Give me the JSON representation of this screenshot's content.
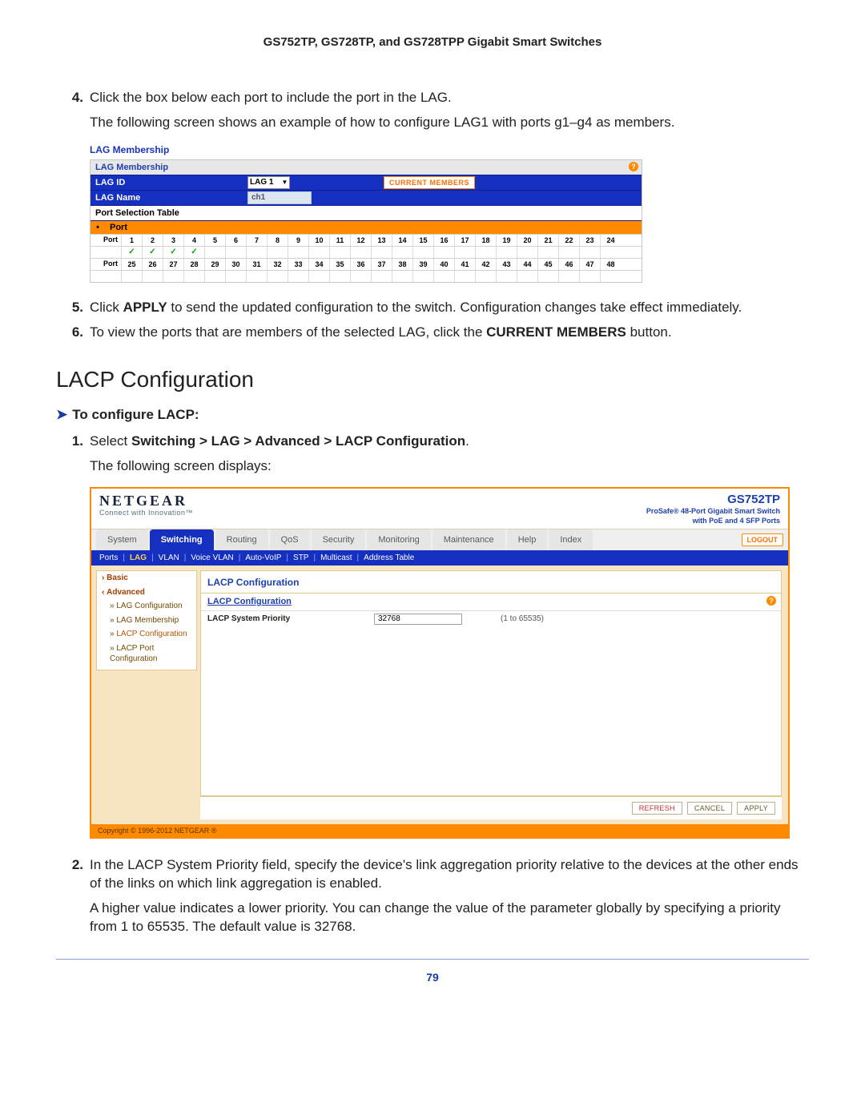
{
  "doc": {
    "header": "GS752TP, GS728TP, and GS728TPP Gigabit Smart Switches",
    "page_number": "79"
  },
  "steps_a": {
    "n4": "4.",
    "t4": "Click the box below each port to include the port in the LAG.",
    "t4b": "The following screen shows an example of how to configure LAG1 with ports g1–g4 as members.",
    "n5": "5.",
    "t5_pre": "Click ",
    "t5_bold": "APPLY",
    "t5_post": " to send the updated configuration to the switch. Configuration changes take effect immediately.",
    "n6": "6.",
    "t6_pre": "To view the ports that are members of the selected LAG, click the ",
    "t6_bold": "CURRENT MEMBERS",
    "t6_post": " button."
  },
  "lacp": {
    "heading": "LACP Configuration",
    "arrow": "➤",
    "task": "To configure LACP:",
    "n1": "1.",
    "t1_pre": "Select ",
    "t1_b1": "Switching",
    "gt": ">",
    "t1_b2": "LAG",
    "t1_b3": "Advanced",
    "t1_b4": "LACP Configuration",
    "t1_post": ".",
    "t1b": "The following screen displays:",
    "n2": "2.",
    "t2": "In the LACP System Priority field, specify the device's link aggregation priority relative to the devices at the other ends of the links on which link aggregation is enabled.",
    "t2b": "A higher value indicates a lower priority. You can change the value of the parameter globally by specifying a priority from 1 to 65535. The default value is 32768."
  },
  "img1": {
    "title": "LAG Membership",
    "bar_title": "LAG Membership",
    "lag_id_label": "LAG ID",
    "lag_select": "LAG 1",
    "current_members_btn": "CURRENT MEMBERS",
    "lag_name_label": "LAG Name",
    "lag_name_value": "ch1",
    "port_table_label": "Port Selection Table",
    "port_header": "Port",
    "port_label": "Port",
    "row1": [
      "1",
      "2",
      "3",
      "4",
      "5",
      "6",
      "7",
      "8",
      "9",
      "10",
      "11",
      "12",
      "13",
      "14",
      "15",
      "16",
      "17",
      "18",
      "19",
      "20",
      "21",
      "22",
      "23",
      "24"
    ],
    "row1_checked": [
      true,
      true,
      true,
      true,
      false,
      false,
      false,
      false,
      false,
      false,
      false,
      false,
      false,
      false,
      false,
      false,
      false,
      false,
      false,
      false,
      false,
      false,
      false,
      false
    ],
    "row2": [
      "25",
      "26",
      "27",
      "28",
      "29",
      "30",
      "31",
      "32",
      "33",
      "34",
      "35",
      "36",
      "37",
      "38",
      "39",
      "40",
      "41",
      "42",
      "43",
      "44",
      "45",
      "46",
      "47",
      "48"
    ]
  },
  "img2": {
    "brand": "NETGEAR",
    "brand_sub": "Connect with Innovation™",
    "model": "GS752TP",
    "model_sub1": "ProSafe® 48-Port Gigabit Smart Switch",
    "model_sub2": "with PoE and 4 SFP Ports",
    "tabs": [
      "System",
      "Switching",
      "Routing",
      "QoS",
      "Security",
      "Monitoring",
      "Maintenance",
      "Help",
      "Index"
    ],
    "active_tab": 1,
    "logout": "LOGOUT",
    "subnav": [
      "Ports",
      "LAG",
      "VLAN",
      "Voice VLAN",
      "Auto-VoIP",
      "STP",
      "Multicast",
      "Address Table"
    ],
    "subnav_active": 1,
    "side": {
      "basic": "Basic",
      "advanced": "Advanced",
      "items": [
        "LAG Configuration",
        "LAG Membership",
        "LACP Configuration",
        "LACP Port Configuration"
      ],
      "active_item": 2
    },
    "panel_title": "LACP Configuration",
    "panel_bar": "LACP Configuration",
    "field_label": "LACP System Priority",
    "field_value": "32768",
    "field_hint": "(1 to 65535)",
    "buttons": {
      "refresh": "REFRESH",
      "cancel": "CANCEL",
      "apply": "APPLY"
    },
    "copyright": "Copyright © 1996-2012 NETGEAR ®"
  }
}
